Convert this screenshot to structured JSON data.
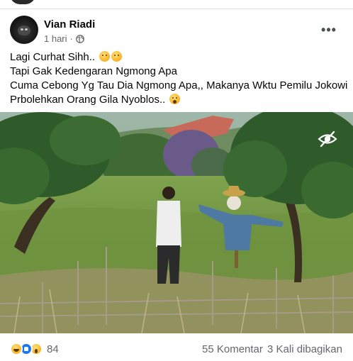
{
  "post": {
    "author": "Vian Riadi",
    "time": "1 hari",
    "separator": "·",
    "privacy_icon": "globe-icon",
    "more_icon": "more-options-icon",
    "more_label": "•••",
    "text_lines": [
      "Lagi Curhat Sihh..",
      "Tapi Gak Kedengaran Ngmong Apa",
      "Cuma Cebong Yg Tau Dia Ngmong Apa,, Makanya Wktu Pemilu Jokowi",
      "Prbolehkan Orang Gila Nyoblos.."
    ],
    "image_overlay_icon": "eye-slash-icon"
  },
  "footer": {
    "reaction_icons": [
      "haha-reaction-icon",
      "like-reaction-icon",
      "wow-reaction-icon"
    ],
    "reaction_count": "84",
    "comments": "55 Komentar",
    "shares": "3 Kali dibagikan"
  },
  "colors": {
    "text_primary": "#050505",
    "text_secondary": "#65676b",
    "like_blue": "#1877f2"
  }
}
